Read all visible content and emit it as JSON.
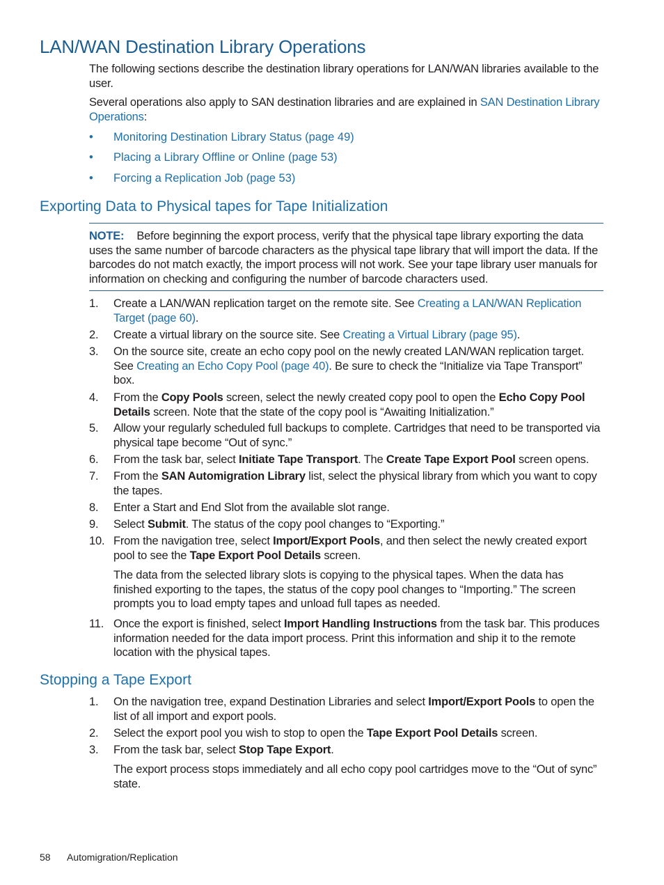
{
  "page": {
    "title": "LAN/WAN Destination Library Operations",
    "intro": "The following sections describe the destination library operations for LAN/WAN libraries available to the user.",
    "intro2_prefix": "Several operations also apply to SAN destination libraries and are explained in ",
    "intro2_link": "SAN Destination Library Operations",
    "intro2_suffix": ":",
    "bullets": [
      "Monitoring Destination Library Status (page 49)",
      "Placing a Library Offline or Online (page 53)",
      "Forcing a Replication Job (page 53)"
    ],
    "bullet_glyph": "•"
  },
  "export_section": {
    "title": "Exporting Data to Physical tapes for Tape Initialization",
    "note_label": "NOTE:",
    "note_text": "Before beginning the export process, verify that the physical tape library exporting the data uses the same number of barcode characters as the physical tape library that will import the data. If the barcodes do not match exactly, the import process will not work. See your tape library user manuals for information on checking and configuring the number of barcode characters used.",
    "steps": [
      {
        "num": "1.",
        "parts": [
          {
            "t": "Create a LAN/WAN replication target on the remote site. See "
          },
          {
            "t": "Creating a LAN/WAN Replication Target (page 60)",
            "link": true
          },
          {
            "t": "."
          }
        ]
      },
      {
        "num": "2.",
        "parts": [
          {
            "t": "Create a virtual library on the source site. See "
          },
          {
            "t": "Creating a Virtual Library (page 95)",
            "link": true
          },
          {
            "t": "."
          }
        ]
      },
      {
        "num": "3.",
        "parts": [
          {
            "t": "On the source site, create an echo copy pool on the newly created LAN/WAN replication target. See "
          },
          {
            "t": "Creating an Echo Copy Pool (page 40)",
            "link": true
          },
          {
            "t": ". Be sure to check the “Initialize via Tape Transport” box."
          }
        ]
      },
      {
        "num": "4.",
        "parts": [
          {
            "t": "From the "
          },
          {
            "t": "Copy Pools",
            "bold": true
          },
          {
            "t": " screen, select the newly created copy pool to open the "
          },
          {
            "t": "Echo Copy Pool Details",
            "bold": true
          },
          {
            "t": " screen. Note that the state of the copy pool is “Awaiting Initialization.”"
          }
        ]
      },
      {
        "num": "5.",
        "parts": [
          {
            "t": "Allow your regularly scheduled full backups to complete. Cartridges that need to be transported via physical tape become “Out of sync.”"
          }
        ]
      },
      {
        "num": "6.",
        "parts": [
          {
            "t": "From the task bar, select "
          },
          {
            "t": "Initiate Tape Transport",
            "bold": true
          },
          {
            "t": ". The "
          },
          {
            "t": "Create Tape Export Pool",
            "bold": true
          },
          {
            "t": " screen opens."
          }
        ]
      },
      {
        "num": "7.",
        "parts": [
          {
            "t": "From the "
          },
          {
            "t": "SAN Automigration Library",
            "bold": true
          },
          {
            "t": " list, select the physical library from which you want to copy the tapes."
          }
        ]
      },
      {
        "num": "8.",
        "parts": [
          {
            "t": "Enter a Start and End Slot from the available slot range."
          }
        ]
      },
      {
        "num": "9.",
        "parts": [
          {
            "t": "Select "
          },
          {
            "t": "Submit",
            "bold": true
          },
          {
            "t": ". The status of the copy pool changes to “Exporting.”"
          }
        ]
      },
      {
        "num": "10.",
        "parts": [
          {
            "t": "From the navigation tree, select "
          },
          {
            "t": "Import/Export Pools",
            "bold": true
          },
          {
            "t": ", and then select the newly created export pool to see the "
          },
          {
            "t": "Tape Export Pool Details",
            "bold": true
          },
          {
            "t": " screen."
          }
        ]
      },
      {
        "num": "11.",
        "parts": [
          {
            "t": "Once the export is finished, select "
          },
          {
            "t": "Import Handling Instructions",
            "bold": true
          },
          {
            "t": " from the task bar. This produces information needed for the data import process. Print this information and ship it to the remote location with the physical tapes."
          }
        ]
      }
    ],
    "step10_followup": "The data from the selected library slots is copying to the physical tapes. When the data has finished exporting to the tapes, the status of the copy pool changes to “Importing.” The screen prompts you to load empty tapes and unload full tapes as needed."
  },
  "stop_section": {
    "title": "Stopping a Tape Export",
    "steps": [
      {
        "num": "1.",
        "parts": [
          {
            "t": "On the navigation tree, expand Destination Libraries and select "
          },
          {
            "t": "Import/Export Pools",
            "bold": true
          },
          {
            "t": " to open the list of all import and export pools."
          }
        ]
      },
      {
        "num": "2.",
        "parts": [
          {
            "t": "Select the export pool you wish to stop to open the "
          },
          {
            "t": "Tape Export Pool Details",
            "bold": true
          },
          {
            "t": " screen."
          }
        ]
      },
      {
        "num": "3.",
        "parts": [
          {
            "t": "From the task bar, select "
          },
          {
            "t": "Stop Tape Export",
            "bold": true
          },
          {
            "t": "."
          }
        ]
      }
    ],
    "step3_followup": "The export process stops immediately and all echo copy pool cartridges move to the “Out of sync” state."
  },
  "footer": {
    "page_number": "58",
    "section": "Automigration/Replication"
  }
}
